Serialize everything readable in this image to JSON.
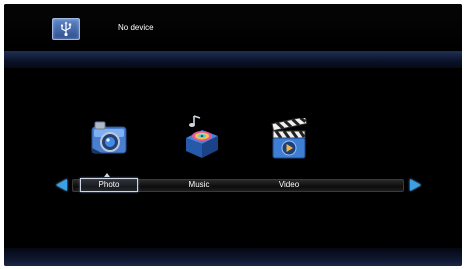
{
  "status": {
    "device_text": "No device",
    "usb_icon": "usb-icon"
  },
  "menu": {
    "selected": "Photo",
    "items": [
      {
        "label": "Photo",
        "icon": "camera-icon"
      },
      {
        "label": "Music",
        "icon": "music-icon"
      },
      {
        "label": "Video",
        "icon": "clapperboard-icon"
      }
    ],
    "nav_left_icon": "arrow-left-icon",
    "nav_right_icon": "arrow-right-icon"
  },
  "colors": {
    "background": "#000000",
    "accent": "#3aa0e8",
    "band": "#1f2f55"
  }
}
